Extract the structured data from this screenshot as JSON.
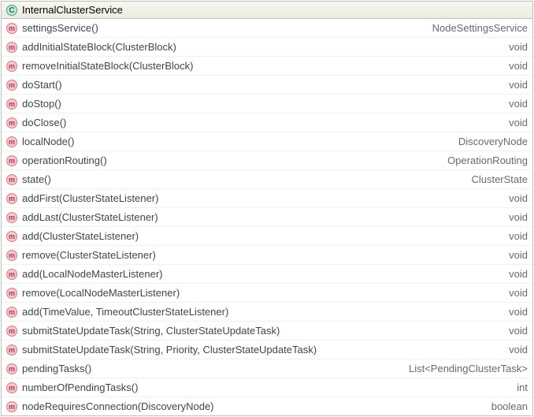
{
  "header": {
    "icon_glyph": "C",
    "title": "InternalClusterService"
  },
  "method_icon_glyph": "m",
  "methods": [
    {
      "signature": "settingsService()",
      "return_type": "NodeSettingsService"
    },
    {
      "signature": "addInitialStateBlock(ClusterBlock)",
      "return_type": "void"
    },
    {
      "signature": "removeInitialStateBlock(ClusterBlock)",
      "return_type": "void"
    },
    {
      "signature": "doStart()",
      "return_type": "void"
    },
    {
      "signature": "doStop()",
      "return_type": "void"
    },
    {
      "signature": "doClose()",
      "return_type": "void"
    },
    {
      "signature": "localNode()",
      "return_type": "DiscoveryNode"
    },
    {
      "signature": "operationRouting()",
      "return_type": "OperationRouting"
    },
    {
      "signature": "state()",
      "return_type": "ClusterState"
    },
    {
      "signature": "addFirst(ClusterStateListener)",
      "return_type": "void"
    },
    {
      "signature": "addLast(ClusterStateListener)",
      "return_type": "void"
    },
    {
      "signature": "add(ClusterStateListener)",
      "return_type": "void"
    },
    {
      "signature": "remove(ClusterStateListener)",
      "return_type": "void"
    },
    {
      "signature": "add(LocalNodeMasterListener)",
      "return_type": "void"
    },
    {
      "signature": "remove(LocalNodeMasterListener)",
      "return_type": "void"
    },
    {
      "signature": "add(TimeValue, TimeoutClusterStateListener)",
      "return_type": "void"
    },
    {
      "signature": "submitStateUpdateTask(String, ClusterStateUpdateTask)",
      "return_type": "void"
    },
    {
      "signature": "submitStateUpdateTask(String, Priority, ClusterStateUpdateTask)",
      "return_type": "void"
    },
    {
      "signature": "pendingTasks()",
      "return_type": "List<PendingClusterTask>"
    },
    {
      "signature": "numberOfPendingTasks()",
      "return_type": "int"
    },
    {
      "signature": "nodeRequiresConnection(DiscoveryNode)",
      "return_type": "boolean"
    }
  ]
}
